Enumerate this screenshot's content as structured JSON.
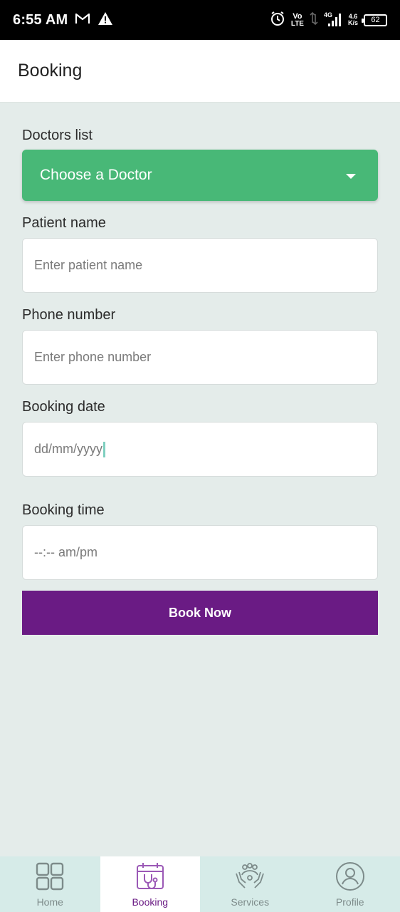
{
  "status_bar": {
    "time": "6:55 AM",
    "network_top": "Vo",
    "network_bottom": "LTE",
    "signal_label": "4G",
    "speed_value": "4.6",
    "speed_unit": "K/s",
    "battery": "62"
  },
  "app_bar": {
    "title": "Booking"
  },
  "form": {
    "doctors_label": "Doctors list",
    "doctor_dropdown": "Choose a Doctor",
    "patient_label": "Patient name",
    "patient_placeholder": "Enter patient name",
    "phone_label": "Phone number",
    "phone_placeholder": "Enter phone number",
    "date_label": "Booking date",
    "date_placeholder": "dd/mm/yyyy",
    "time_label": "Booking time",
    "time_placeholder": "--:-- am/pm",
    "submit_label": "Book Now"
  },
  "bottom_nav": {
    "items": [
      {
        "label": "Home",
        "icon": "grid-icon"
      },
      {
        "label": "Booking",
        "icon": "calendar-stethoscope-icon"
      },
      {
        "label": "Services",
        "icon": "hands-people-icon"
      },
      {
        "label": "Profile",
        "icon": "user-circle-icon"
      }
    ],
    "active_index": 1
  },
  "colors": {
    "accent_green": "#48b877",
    "accent_purple": "#6a1b84",
    "background": "#e4ecea",
    "nav_background": "#d6ebe8"
  }
}
